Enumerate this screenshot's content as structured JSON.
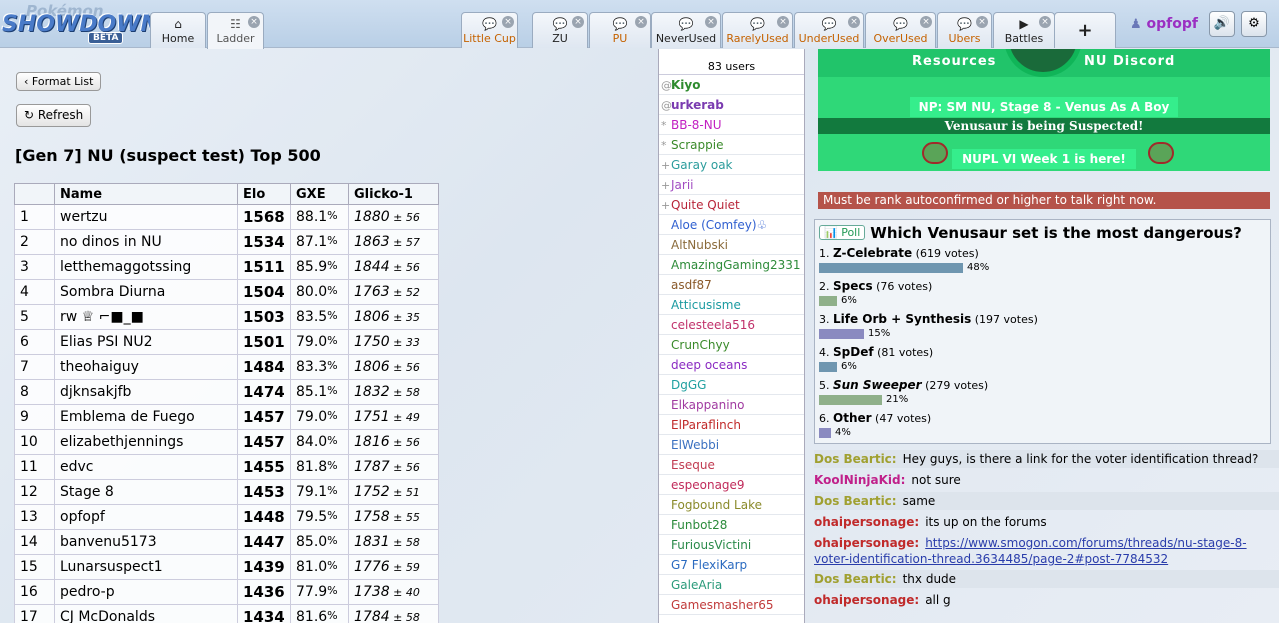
{
  "logo": {
    "line1": "Pokémon",
    "line2": "SHOWDOWN!",
    "beta": "BETA"
  },
  "tabs": [
    {
      "label": "Home",
      "icon": "⌂"
    },
    {
      "label": "Ladder",
      "icon": "☷"
    },
    {
      "label": "Little Cup",
      "icon": "💬"
    },
    {
      "label": "ZU",
      "icon": "💬"
    },
    {
      "label": "PU",
      "icon": "💬"
    },
    {
      "label": "NeverUsed",
      "icon": "💬"
    },
    {
      "label": "RarelyUsed",
      "icon": "💬"
    },
    {
      "label": "UnderUsed",
      "icon": "💬"
    },
    {
      "label": "OverUsed",
      "icon": "💬"
    },
    {
      "label": "Ubers",
      "icon": "💬"
    },
    {
      "label": "Battles",
      "icon": "▶"
    },
    {
      "label": "+",
      "icon": ""
    }
  ],
  "user": {
    "name": "opfopf",
    "icon": "♟"
  },
  "icons": {
    "sound": "🔊",
    "settings": "⚙",
    "close": "×",
    "poll": "📊"
  },
  "ladder": {
    "format_list": "Format List",
    "refresh": "Refresh",
    "title": "[Gen 7] NU (suspect test) Top 500",
    "columns": [
      "",
      "Name",
      "Elo",
      "GXE",
      "Glicko-1"
    ],
    "rows": [
      {
        "rank": "1",
        "name": "wertzu",
        "elo": "1568",
        "gxe": "88.1",
        "glicko": "1880",
        "dev": "56"
      },
      {
        "rank": "2",
        "name": "no dinos in NU",
        "elo": "1534",
        "gxe": "87.1",
        "glicko": "1863",
        "dev": "57"
      },
      {
        "rank": "3",
        "name": "letthemaggotssing",
        "elo": "1511",
        "gxe": "85.9",
        "glicko": "1844",
        "dev": "56"
      },
      {
        "rank": "4",
        "name": "Sombra Diurna",
        "elo": "1504",
        "gxe": "80.0",
        "glicko": "1763",
        "dev": "52"
      },
      {
        "rank": "5",
        "name": "rw ♕ ⌐■_■",
        "elo": "1503",
        "gxe": "83.5",
        "glicko": "1806",
        "dev": "35"
      },
      {
        "rank": "6",
        "name": "Elias PSI NU2",
        "elo": "1501",
        "gxe": "79.0",
        "glicko": "1750",
        "dev": "33"
      },
      {
        "rank": "7",
        "name": "theohaiguy",
        "elo": "1484",
        "gxe": "83.3",
        "glicko": "1806",
        "dev": "56"
      },
      {
        "rank": "8",
        "name": "djknsakjfb",
        "elo": "1474",
        "gxe": "85.1",
        "glicko": "1832",
        "dev": "58"
      },
      {
        "rank": "9",
        "name": "Emblema de Fuego",
        "elo": "1457",
        "gxe": "79.0",
        "glicko": "1751",
        "dev": "49"
      },
      {
        "rank": "10",
        "name": "elizabethjennings",
        "elo": "1457",
        "gxe": "84.0",
        "glicko": "1816",
        "dev": "56"
      },
      {
        "rank": "11",
        "name": "edvc",
        "elo": "1455",
        "gxe": "81.8",
        "glicko": "1787",
        "dev": "56"
      },
      {
        "rank": "12",
        "name": "Stage 8",
        "elo": "1453",
        "gxe": "79.1",
        "glicko": "1752",
        "dev": "51"
      },
      {
        "rank": "13",
        "name": "opfopf",
        "elo": "1448",
        "gxe": "79.5",
        "glicko": "1758",
        "dev": "55"
      },
      {
        "rank": "14",
        "name": "banvenu5173",
        "elo": "1447",
        "gxe": "85.0",
        "glicko": "1831",
        "dev": "58"
      },
      {
        "rank": "15",
        "name": "Lunarsuspect1",
        "elo": "1439",
        "gxe": "81.0",
        "glicko": "1776",
        "dev": "59"
      },
      {
        "rank": "16",
        "name": "pedro-p",
        "elo": "1436",
        "gxe": "77.9",
        "glicko": "1738",
        "dev": "40"
      },
      {
        "rank": "17",
        "name": "CJ McDonalds",
        "elo": "1434",
        "gxe": "81.6",
        "glicko": "1784",
        "dev": "58"
      }
    ]
  },
  "userlist": {
    "count": "83 users",
    "users": [
      {
        "group": "@",
        "name": "Kiyo",
        "color": "#2e8b2e",
        "bold": true
      },
      {
        "group": "@",
        "name": "urkerab",
        "color": "#7a3bb0",
        "bold": true
      },
      {
        "group": "*",
        "name": "BB-8-NU",
        "color": "#c21fc2"
      },
      {
        "group": "*",
        "name": "Scrappie",
        "color": "#3a8a2a"
      },
      {
        "group": "+",
        "name": "Garay oak",
        "color": "#2b9c9c"
      },
      {
        "group": "+",
        "name": "Jarii",
        "color": "#a24dc2"
      },
      {
        "group": "+",
        "name": "Quite Quiet",
        "color": "#b8263a"
      },
      {
        "group": "",
        "name": "Aloe (Comfey)♧",
        "color": "#3060d0"
      },
      {
        "group": "",
        "name": "AltNubski",
        "color": "#8a6a3a"
      },
      {
        "group": "",
        "name": "AmazingGaming2331",
        "color": "#2e8b3a"
      },
      {
        "group": "",
        "name": "asdf87",
        "color": "#8a5a2a"
      },
      {
        "group": "",
        "name": "Atticusisme",
        "color": "#1a9aa0"
      },
      {
        "group": "",
        "name": "celesteela516",
        "color": "#c0306a"
      },
      {
        "group": "",
        "name": "CrunChyy",
        "color": "#3a8a2a"
      },
      {
        "group": "",
        "name": "deep oceans",
        "color": "#8a2ac2"
      },
      {
        "group": "",
        "name": "DgGG",
        "color": "#20a0a0"
      },
      {
        "group": "",
        "name": "Elkappanino",
        "color": "#a03aa0"
      },
      {
        "group": "",
        "name": "ElParaflinch",
        "color": "#c02a2a"
      },
      {
        "group": "",
        "name": "ElWebbi",
        "color": "#3a70c0"
      },
      {
        "group": "",
        "name": "Eseque",
        "color": "#c03a50"
      },
      {
        "group": "",
        "name": "espeonage9",
        "color": "#c02a5a"
      },
      {
        "group": "",
        "name": "Fogbound Lake",
        "color": "#8a8a2a"
      },
      {
        "group": "",
        "name": "Funbot28",
        "color": "#2a8a3a"
      },
      {
        "group": "",
        "name": "FuriousVictini",
        "color": "#2a8a4a"
      },
      {
        "group": "",
        "name": "G7 FlexiKarp",
        "color": "#2a6ac0"
      },
      {
        "group": "",
        "name": "GaleAria",
        "color": "#2a9a7a"
      },
      {
        "group": "",
        "name": "Gamesmasher65",
        "color": "#c03a3a"
      }
    ]
  },
  "banner": {
    "resources": "Resources",
    "discord": "NU Discord",
    "np": "NP: SM NU, Stage 8 - Venus As A Boy",
    "suspect": "Venusaur is being Suspected!",
    "nupl": "NUPL VI Week 1 is here!"
  },
  "rank_message": "Must be rank autoconfirmed or higher to talk right now.",
  "poll": {
    "tag": "Poll",
    "question": "Which Venusaur set is the most dangerous?",
    "options": [
      {
        "num": "1.",
        "name": "Z-Celebrate",
        "votes": "(619 votes)",
        "pct": "48%",
        "value": 0.48,
        "color": "#6f96b0",
        "italic": false
      },
      {
        "num": "2.",
        "name": "Specs",
        "votes": "(76 votes)",
        "pct": "6%",
        "value": 0.06,
        "color": "#8fb08a",
        "italic": false
      },
      {
        "num": "3.",
        "name": "Life Orb + Synthesis",
        "votes": "(197 votes)",
        "pct": "15%",
        "value": 0.15,
        "color": "#8a8ac0",
        "italic": false
      },
      {
        "num": "4.",
        "name": "SpDef",
        "votes": "(81 votes)",
        "pct": "6%",
        "value": 0.06,
        "color": "#6f96b0",
        "italic": false
      },
      {
        "num": "5.",
        "name": "Sun Sweeper",
        "votes": "(279 votes)",
        "pct": "21%",
        "value": 0.21,
        "color": "#8fb08a",
        "italic": true
      },
      {
        "num": "6.",
        "name": "Other",
        "votes": "(47 votes)",
        "pct": "4%",
        "value": 0.04,
        "color": "#8a8ac0",
        "italic": false
      }
    ]
  },
  "chat": [
    {
      "name": "Dos Beartic:",
      "color": "#a0a030",
      "text": "Hey guys, is there a link for the voter identification thread?",
      "alt": true
    },
    {
      "name": "KoolNinjaKid:",
      "color": "#c0208a",
      "text": "not sure",
      "alt": false
    },
    {
      "name": "Dos Beartic:",
      "color": "#a0a030",
      "text": "same",
      "alt": true
    },
    {
      "name": "ohaipersonage:",
      "color": "#c02a2a",
      "text": "its up on the forums",
      "alt": false
    },
    {
      "name": "ohaipersonage:",
      "color": "#c02a2a",
      "text": "",
      "link": "https://www.smogon.com/forums/threads/nu-stage-8-voter-identification-thread.3634485/page-2#post-7784532",
      "alt": false
    },
    {
      "name": "Dos Beartic:",
      "color": "#a0a030",
      "text": "thx dude",
      "alt": true
    },
    {
      "name": "ohaipersonage:",
      "color": "#c02a2a",
      "text": "all g",
      "alt": false
    }
  ]
}
